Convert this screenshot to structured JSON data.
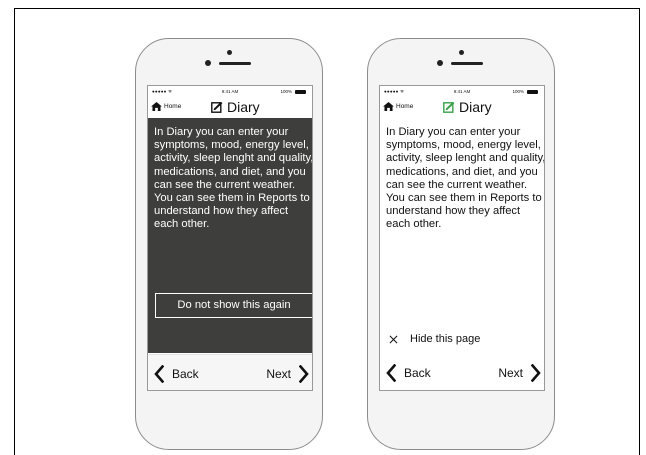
{
  "status_bar": {
    "signal": "●●●●● ᯤ",
    "time": "9:41 AM",
    "battery": "100%"
  },
  "nav": {
    "home_label": "Home",
    "title": "Diary"
  },
  "body_text": "In Diary you can enter your symptoms, mood, energy level, activity, sleep lenght and quality, medications, and diet, and you can see the current weather. You can see them in Reports to understand how they affect each other.",
  "left_screen": {
    "dont_show_label": "Do not show this again"
  },
  "right_screen": {
    "hide_label": "Hide this page"
  },
  "bottom_nav": {
    "back_label": "Back",
    "next_label": "Next"
  },
  "colors": {
    "dark_panel": "#3e3e3c",
    "diary_icon_left": "#111111",
    "diary_icon_right": "#3aa04a"
  },
  "icons": [
    "home-icon",
    "diary-icon",
    "chevron-left-icon",
    "chevron-right-icon",
    "close-icon",
    "battery-icon"
  ]
}
